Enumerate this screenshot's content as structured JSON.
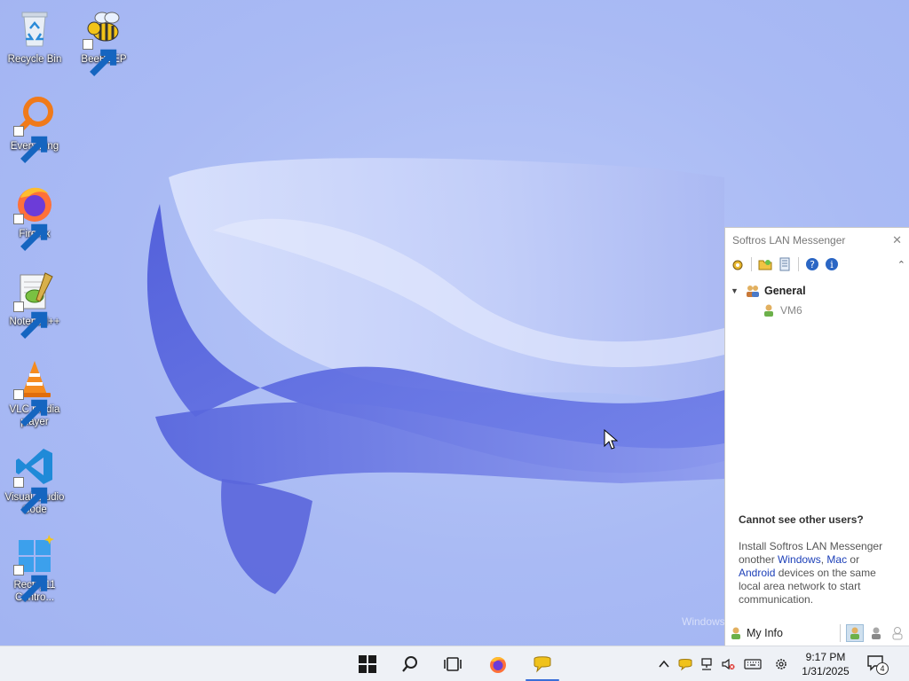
{
  "desktop": {
    "watermark": "Windows",
    "icons": [
      {
        "label": "Recycle Bin",
        "icon": "recycle-bin-icon"
      },
      {
        "label": "BeeBEEP",
        "icon": "bee-icon"
      },
      {
        "label": "Everything",
        "icon": "magnifier-icon"
      },
      {
        "label": "Firefox",
        "icon": "firefox-icon"
      },
      {
        "label": "Notepad++",
        "icon": "notepad-icon"
      },
      {
        "label": "VLC media player",
        "icon": "vlc-cone-icon"
      },
      {
        "label": "Visual Studio Code",
        "icon": "vscode-icon"
      },
      {
        "label": "Rectify11 Contro...",
        "icon": "rectify-icon"
      }
    ]
  },
  "messenger": {
    "title": "Softros LAN Messenger",
    "toolbar": [
      "settings-icon",
      "folder-icon",
      "log-icon",
      "help-icon",
      "info-icon"
    ],
    "group": {
      "name": "General"
    },
    "users": [
      {
        "name": "VM6"
      }
    ],
    "help": {
      "title": "Cannot see other users?",
      "text_before": "Install Softros LAN Messenger onother ",
      "link_windows": "Windows",
      "sep1": ", ",
      "link_mac": "Mac",
      "sep2": " or ",
      "link_android": "Android",
      "text_after": " devices on the same local area network to start communication."
    },
    "footer": {
      "my_info": "My Info"
    }
  },
  "taskbar": {
    "apps": [
      "start-icon",
      "search-icon",
      "task-view-icon",
      "firefox-icon",
      "lan-messenger-icon"
    ],
    "time": "9:17 PM",
    "date": "1/31/2025",
    "notification_count": "4"
  },
  "colors": {
    "accent": "#3a6fd8",
    "wallpaper": "#a9baf4",
    "link": "#1c3fb8"
  }
}
